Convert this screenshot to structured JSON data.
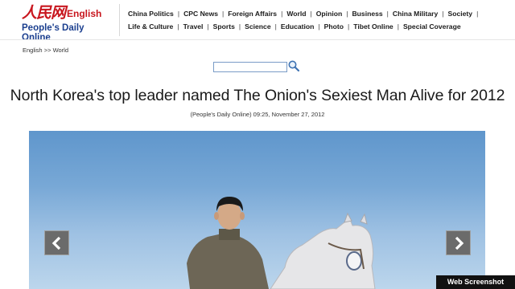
{
  "logo": {
    "chinese": "人民网",
    "english": "English",
    "subtitle": "People's Daily Online"
  },
  "nav": {
    "row1": [
      "China Politics",
      "CPC News",
      "Foreign Affairs",
      "World",
      "Opinion",
      "Business",
      "China Military",
      "Society"
    ],
    "row2": [
      "Life & Culture",
      "Travel",
      "Sports",
      "Science",
      "Education",
      "Photo",
      "Tibet Online",
      "Special Coverage"
    ],
    "separator": "|"
  },
  "breadcrumb": {
    "home": "English",
    "sep": ">>",
    "current": "World"
  },
  "search": {
    "value": ""
  },
  "article": {
    "title": "North Korea's top leader named The Onion's Sexiest Man Alive for 2012",
    "source": "(People's Daily Online)",
    "datetime": "09:25, November 27, 2012"
  },
  "watermark": "Web Screenshot",
  "colors": {
    "brand_red": "#c8161e",
    "brand_blue": "#1b3f8f",
    "sky": "#78a8d6"
  }
}
